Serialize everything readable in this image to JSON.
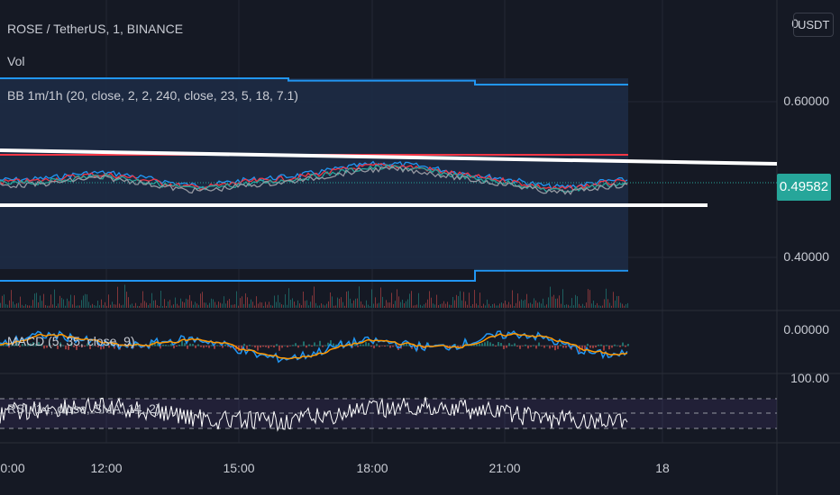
{
  "header": {
    "symbol": "ROSE / TetherUS, 1, BINANCE",
    "volume": "Vol",
    "bb": "BB 1m/1h (20, close, 2, 2, 240, close, 23, 5, 18, 7.1)",
    "currency_button": "USDT"
  },
  "indicators": {
    "macd": "MACD (5, 35, close, 9)",
    "rsi": "RSI (14, close, SMA, 14, 2)"
  },
  "chart_data": {
    "type": "line",
    "title": "ROSE / TetherUS, 1, BINANCE",
    "price_axis": {
      "ticks": [
        "0",
        "0.60000",
        "0.40000"
      ],
      "range": [
        0.35,
        0.64
      ]
    },
    "last_price": "0.49582",
    "macd_axis": {
      "ticks": [
        "0.00000"
      ]
    },
    "rsi_axis": {
      "ticks": [
        "100.00"
      ]
    },
    "x_ticks": [
      "0:00",
      "12:00",
      "15:00",
      "18:00",
      "21:00",
      "18"
    ],
    "bb_upper_outer": [
      0.63,
      0.627,
      0.622
    ],
    "bb_lower_outer": [
      0.37,
      0.383,
      0.385
    ],
    "trendlines": [
      {
        "name": "upper",
        "from": 0.513,
        "to": 0.496
      },
      {
        "name": "lower",
        "from": 0.46,
        "to": 0.46
      }
    ],
    "colors": {
      "band": "#2196f3",
      "price_last": "#26a69a",
      "macd": "#2196f3",
      "signal": "#ff9800",
      "rsi": "#ffffff",
      "red_line": "#f23645"
    }
  }
}
